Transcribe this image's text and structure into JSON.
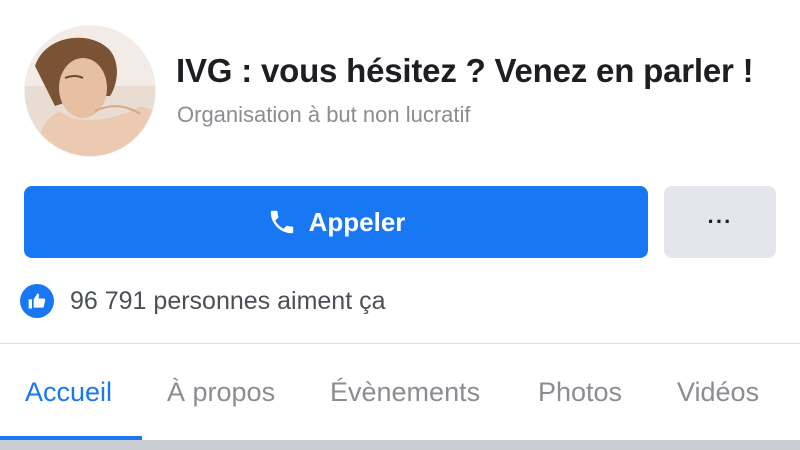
{
  "page": {
    "title": "IVG : vous hésitez ? Venez en parler !",
    "category": "Organisation à but non lucratif"
  },
  "actions": {
    "call_label": "Appeler",
    "more_label": "···"
  },
  "likes": {
    "text": "96 791 personnes aiment ça"
  },
  "tabs": [
    {
      "label": "Accueil",
      "active": true
    },
    {
      "label": "À propos",
      "active": false
    },
    {
      "label": "Évènements",
      "active": false
    },
    {
      "label": "Photos",
      "active": false
    },
    {
      "label": "Vidéos",
      "active": false
    }
  ],
  "colors": {
    "accent": "#1877f2",
    "secondary_button": "#e4e6eb",
    "muted_text": "#8a8d91"
  },
  "icons": {
    "call": "phone-icon",
    "more": "more-icon",
    "like": "thumbs-up-icon"
  }
}
